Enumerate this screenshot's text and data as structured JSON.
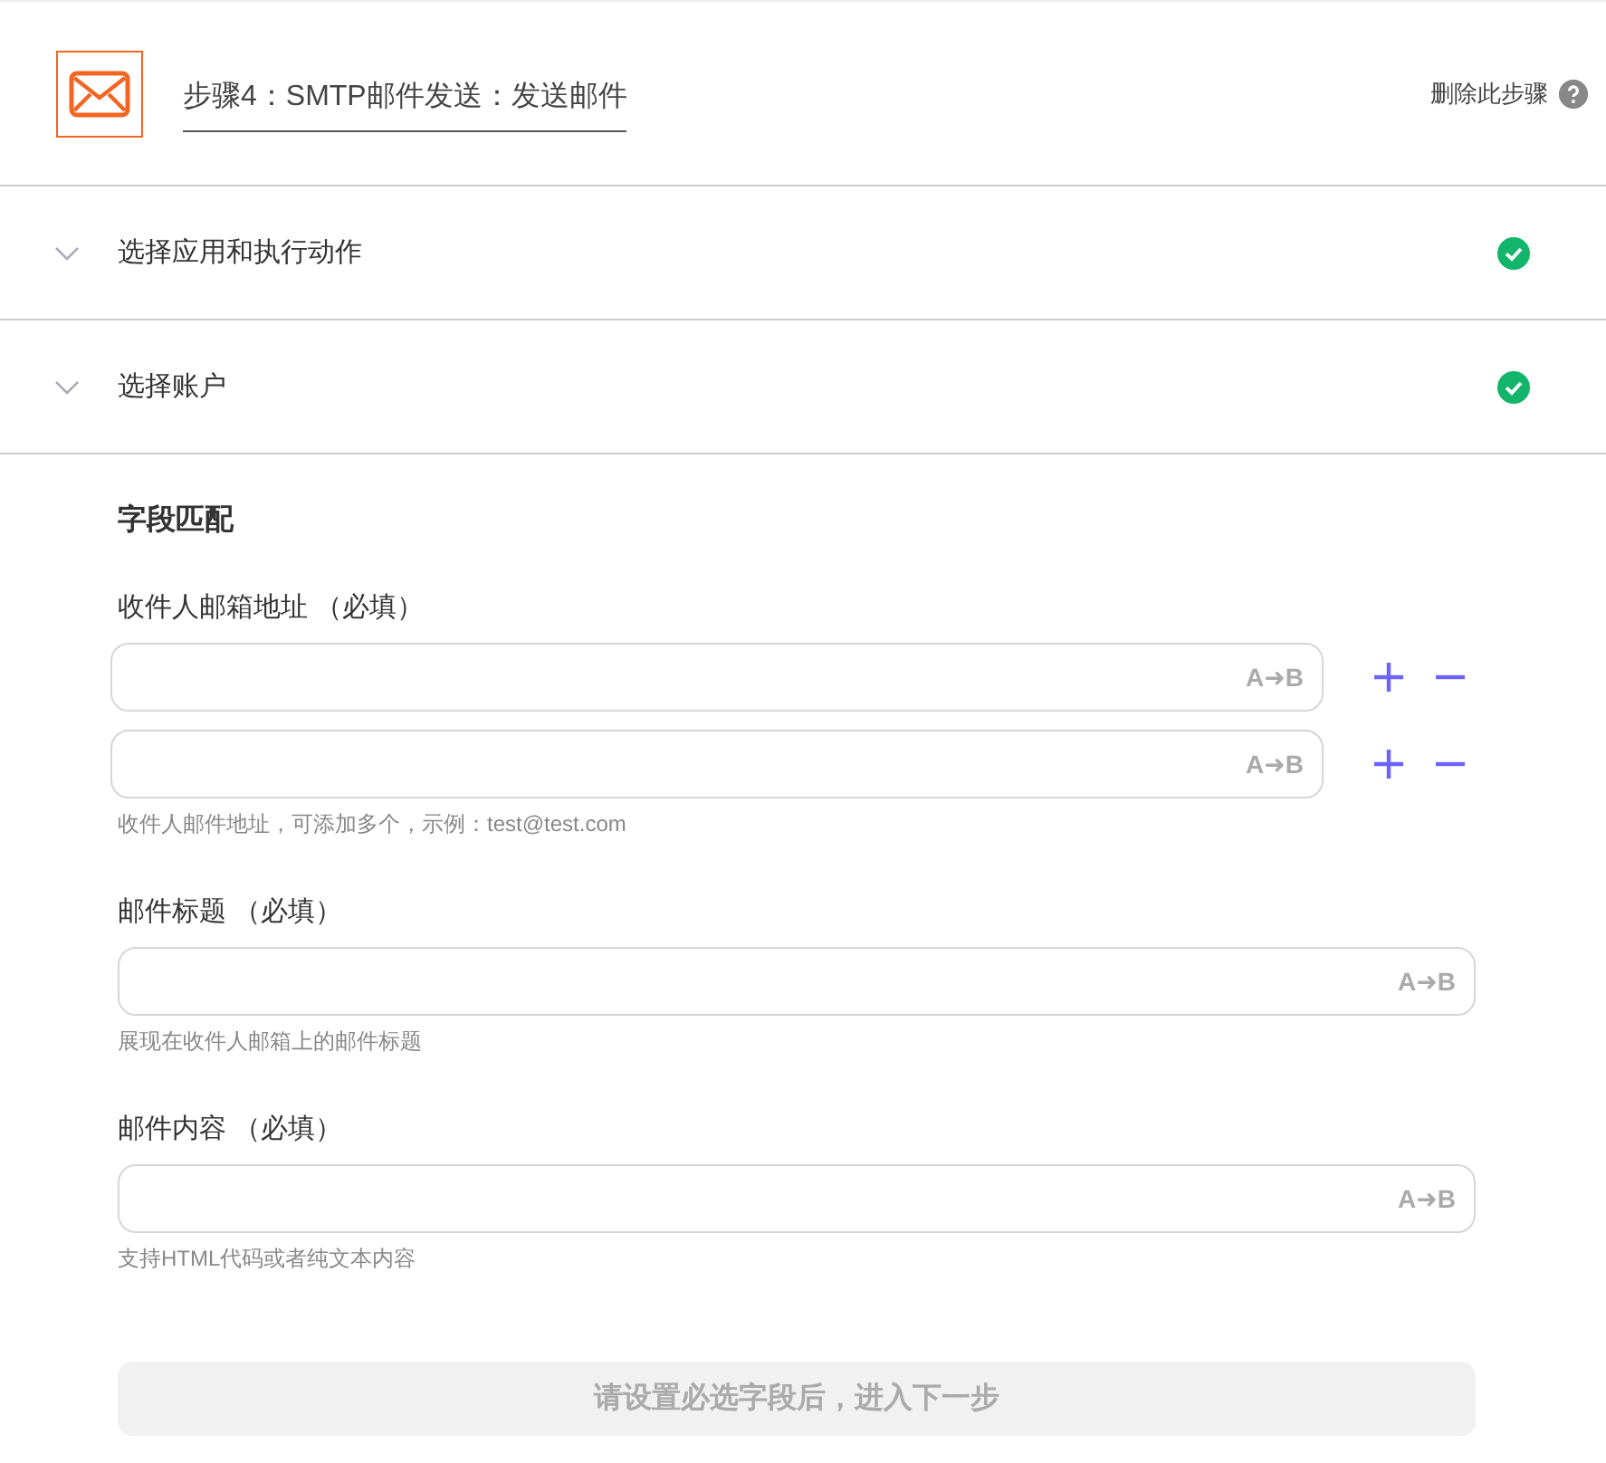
{
  "header": {
    "title": "步骤4：SMTP邮件发送：发送邮件",
    "delete_link": "删除此步骤"
  },
  "sections": [
    {
      "label": "选择应用和执行动作",
      "expanded": false,
      "done": true
    },
    {
      "label": "选择账户",
      "expanded": false,
      "done": true
    }
  ],
  "field_mapping": {
    "heading": "字段匹配",
    "fields": [
      {
        "kind": "multi",
        "label": "收件人邮箱地址 （必填）",
        "inputs": [
          {
            "insert_label": "A➜B"
          },
          {
            "insert_label": "A➜B"
          }
        ],
        "hint": "收件人邮件地址，可添加多个，示例：test@test.com"
      },
      {
        "kind": "single",
        "label": "邮件标题 （必填）",
        "inputs": [
          {
            "insert_label": "A➜B"
          }
        ],
        "hint": "展现在收件人邮箱上的邮件标题"
      },
      {
        "kind": "single",
        "label": "邮件内容 （必填）",
        "inputs": [
          {
            "insert_label": "A➜B"
          }
        ],
        "hint": "支持HTML代码或者纯文本内容"
      }
    ]
  },
  "next_button": {
    "label": "请设置必选字段后，进入下一步",
    "disabled": true
  }
}
